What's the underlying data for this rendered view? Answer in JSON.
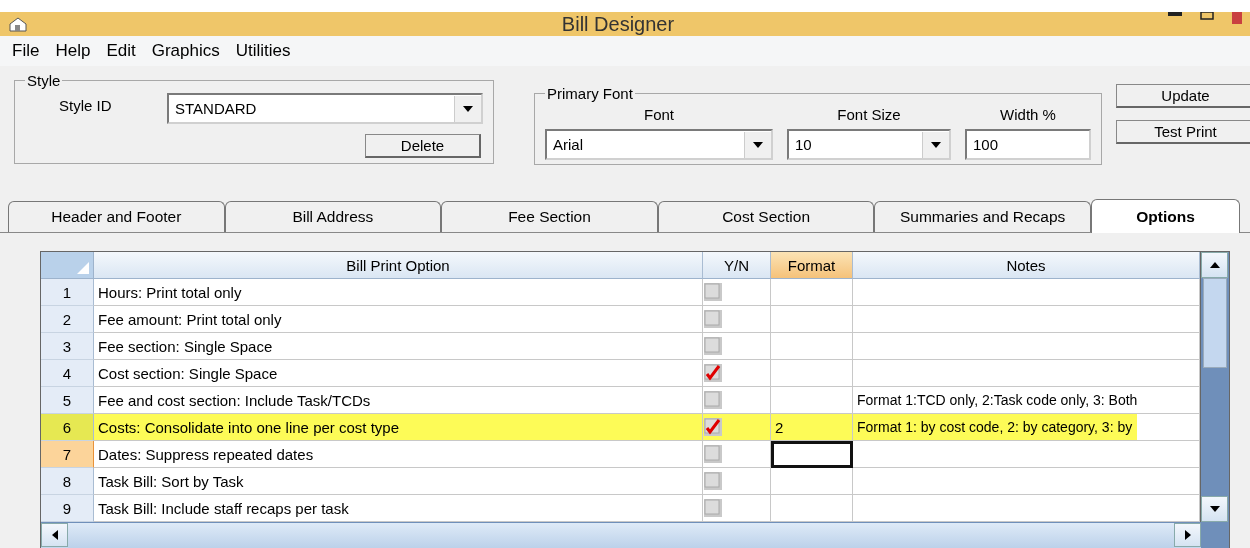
{
  "window": {
    "title": "Bill Designer"
  },
  "menu": [
    "File",
    "Help",
    "Edit",
    "Graphics",
    "Utilities"
  ],
  "style_group": {
    "legend": "Style",
    "style_id_label": "Style ID",
    "style_id_value": "STANDARD",
    "delete_button": "Delete"
  },
  "font_group": {
    "legend": "Primary Font",
    "fields": [
      {
        "label": "Font",
        "value": "Arial",
        "kind": "dropdown"
      },
      {
        "label": "Font Size",
        "value": "10",
        "kind": "dropdown"
      },
      {
        "label": "Width %",
        "value": "100",
        "kind": "text"
      }
    ]
  },
  "buttons": [
    "Update",
    "Test Print"
  ],
  "tabs": [
    {
      "label": "Header and Footer",
      "selected": false
    },
    {
      "label": "Bill Address",
      "selected": false
    },
    {
      "label": "Fee Section",
      "selected": false
    },
    {
      "label": "Cost Section",
      "selected": false
    },
    {
      "label": "Summaries and Recaps",
      "selected": false
    },
    {
      "label": "Options",
      "selected": true
    }
  ],
  "grid": {
    "columns": [
      {
        "label": "Bill Print Option",
        "selected": false
      },
      {
        "label": "Y/N",
        "selected": false
      },
      {
        "label": "Format",
        "selected": true
      },
      {
        "label": "Notes",
        "selected": false
      }
    ],
    "rows": [
      {
        "number": "1",
        "option": "Hours: Print total only",
        "checked": false,
        "format": "",
        "notes": "",
        "highlighted": false,
        "selected": false
      },
      {
        "number": "2",
        "option": "Fee amount: Print total only",
        "checked": false,
        "format": "",
        "notes": "",
        "highlighted": false,
        "selected": false
      },
      {
        "number": "3",
        "option": "Fee section: Single Space",
        "checked": false,
        "format": "",
        "notes": "",
        "highlighted": false,
        "selected": false
      },
      {
        "number": "4",
        "option": "Cost section: Single Space",
        "checked": true,
        "format": "",
        "notes": "",
        "highlighted": false,
        "selected": false
      },
      {
        "number": "5",
        "option": "Fee and cost section: Include Task/TCDs",
        "checked": false,
        "format": "",
        "notes": "Format 1:TCD only, 2:Task code only, 3: Both",
        "highlighted": false,
        "selected": false
      },
      {
        "number": "6",
        "option": "Costs: Consolidate into one line per cost type",
        "checked": true,
        "format": "2",
        "notes": "Format 1: by cost code, 2: by category, 3: by",
        "highlighted": true,
        "selected": false
      },
      {
        "number": "7",
        "option": "Dates: Suppress repeated dates",
        "checked": false,
        "format": "",
        "notes": "",
        "highlighted": false,
        "selected": true
      },
      {
        "number": "8",
        "option": "Task Bill: Sort by Task",
        "checked": false,
        "format": "",
        "notes": "",
        "highlighted": false,
        "selected": false
      },
      {
        "number": "9",
        "option": "Task Bill: Include staff recaps per task",
        "checked": false,
        "format": "",
        "notes": "",
        "highlighted": false,
        "selected": false
      }
    ]
  }
}
